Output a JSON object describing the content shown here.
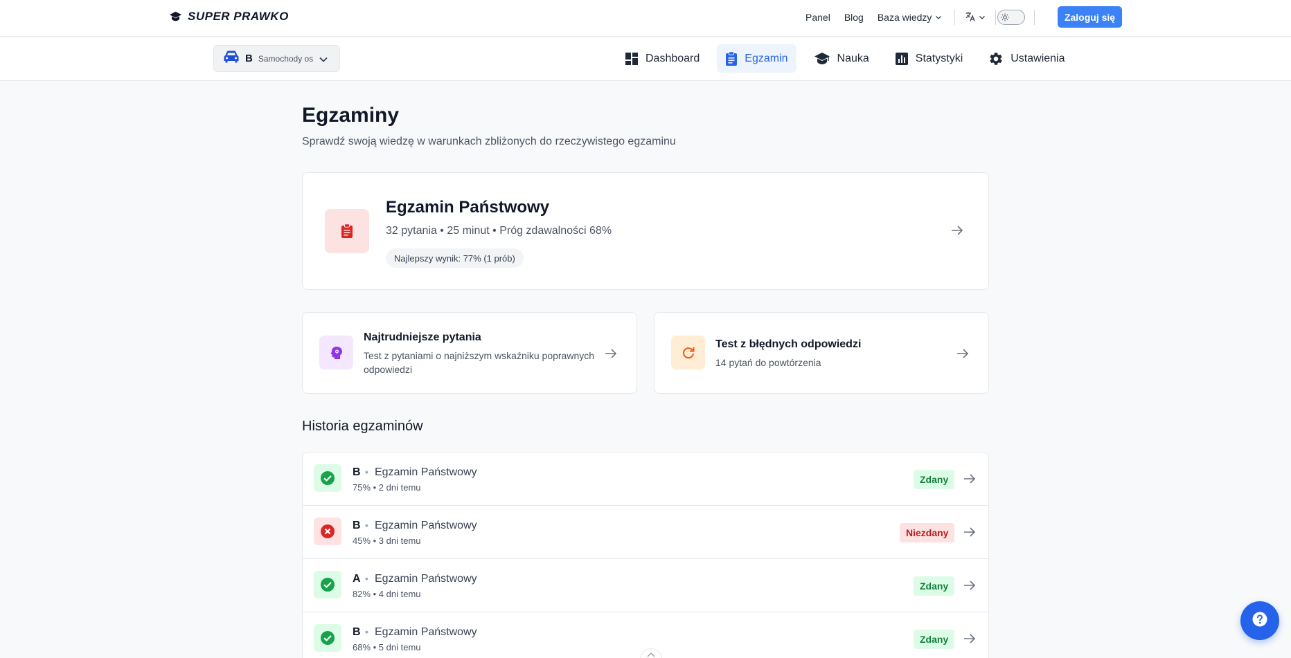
{
  "topbar": {
    "logo_text": "SUPER PRAWKO",
    "links": [
      "Panel",
      "Blog"
    ],
    "dropdown_label": "Baza wiedzy",
    "login_label": "Zaloguj się"
  },
  "category": {
    "letter": "B",
    "name": "Samochody os"
  },
  "nav": [
    {
      "label": "Dashboard",
      "icon": "dashboard-icon",
      "active": false
    },
    {
      "label": "Egzamin",
      "icon": "clipboard-icon",
      "active": true
    },
    {
      "label": "Nauka",
      "icon": "graduation-cap-icon",
      "active": false
    },
    {
      "label": "Statystyki",
      "icon": "bar-chart-icon",
      "active": false
    },
    {
      "label": "Ustawienia",
      "icon": "gear-icon",
      "active": false
    }
  ],
  "page": {
    "title": "Egzaminy",
    "subtitle": "Sprawdź swoją wiedzę w warunkach zbliżonych do rzeczywistego egzaminu"
  },
  "exam_card": {
    "title": "Egzamin Państwowy",
    "meta": "32 pytania • 25 minut • Próg zdawalności 68%",
    "best": "Najlepszy wynik: 77% (1 prób)"
  },
  "hard_card": {
    "title": "Najtrudniejsze pytania",
    "desc_line1": "Test z pytaniami o najniższym wskaźniku poprawnych",
    "desc_line2": "odpowiedzi"
  },
  "wrong_card": {
    "title": "Test z błędnych odpowiedzi",
    "desc": "14 pytań do powtórzenia"
  },
  "history": {
    "title": "Historia egzaminów",
    "rows": [
      {
        "category": "B",
        "name": "Egzamin Państwowy",
        "sub": "75% • 2 dni temu",
        "status": "Zdany",
        "passed": true
      },
      {
        "category": "B",
        "name": "Egzamin Państwowy",
        "sub": "45% • 3 dni temu",
        "status": "Niezdany",
        "passed": false
      },
      {
        "category": "A",
        "name": "Egzamin Państwowy",
        "sub": "82% • 4 dni temu",
        "status": "Zdany",
        "passed": true
      },
      {
        "category": "B",
        "name": "Egzamin Państwowy",
        "sub": "68% • 5 dni temu",
        "status": "Zdany",
        "passed": true
      }
    ]
  },
  "colors": {
    "accent": "#3b82f6",
    "pass": "#16a34a",
    "fail": "#dc2626",
    "exam_icon": "#dc2626",
    "hard_icon": "#9333ea",
    "wrong_icon": "#ea580c"
  }
}
